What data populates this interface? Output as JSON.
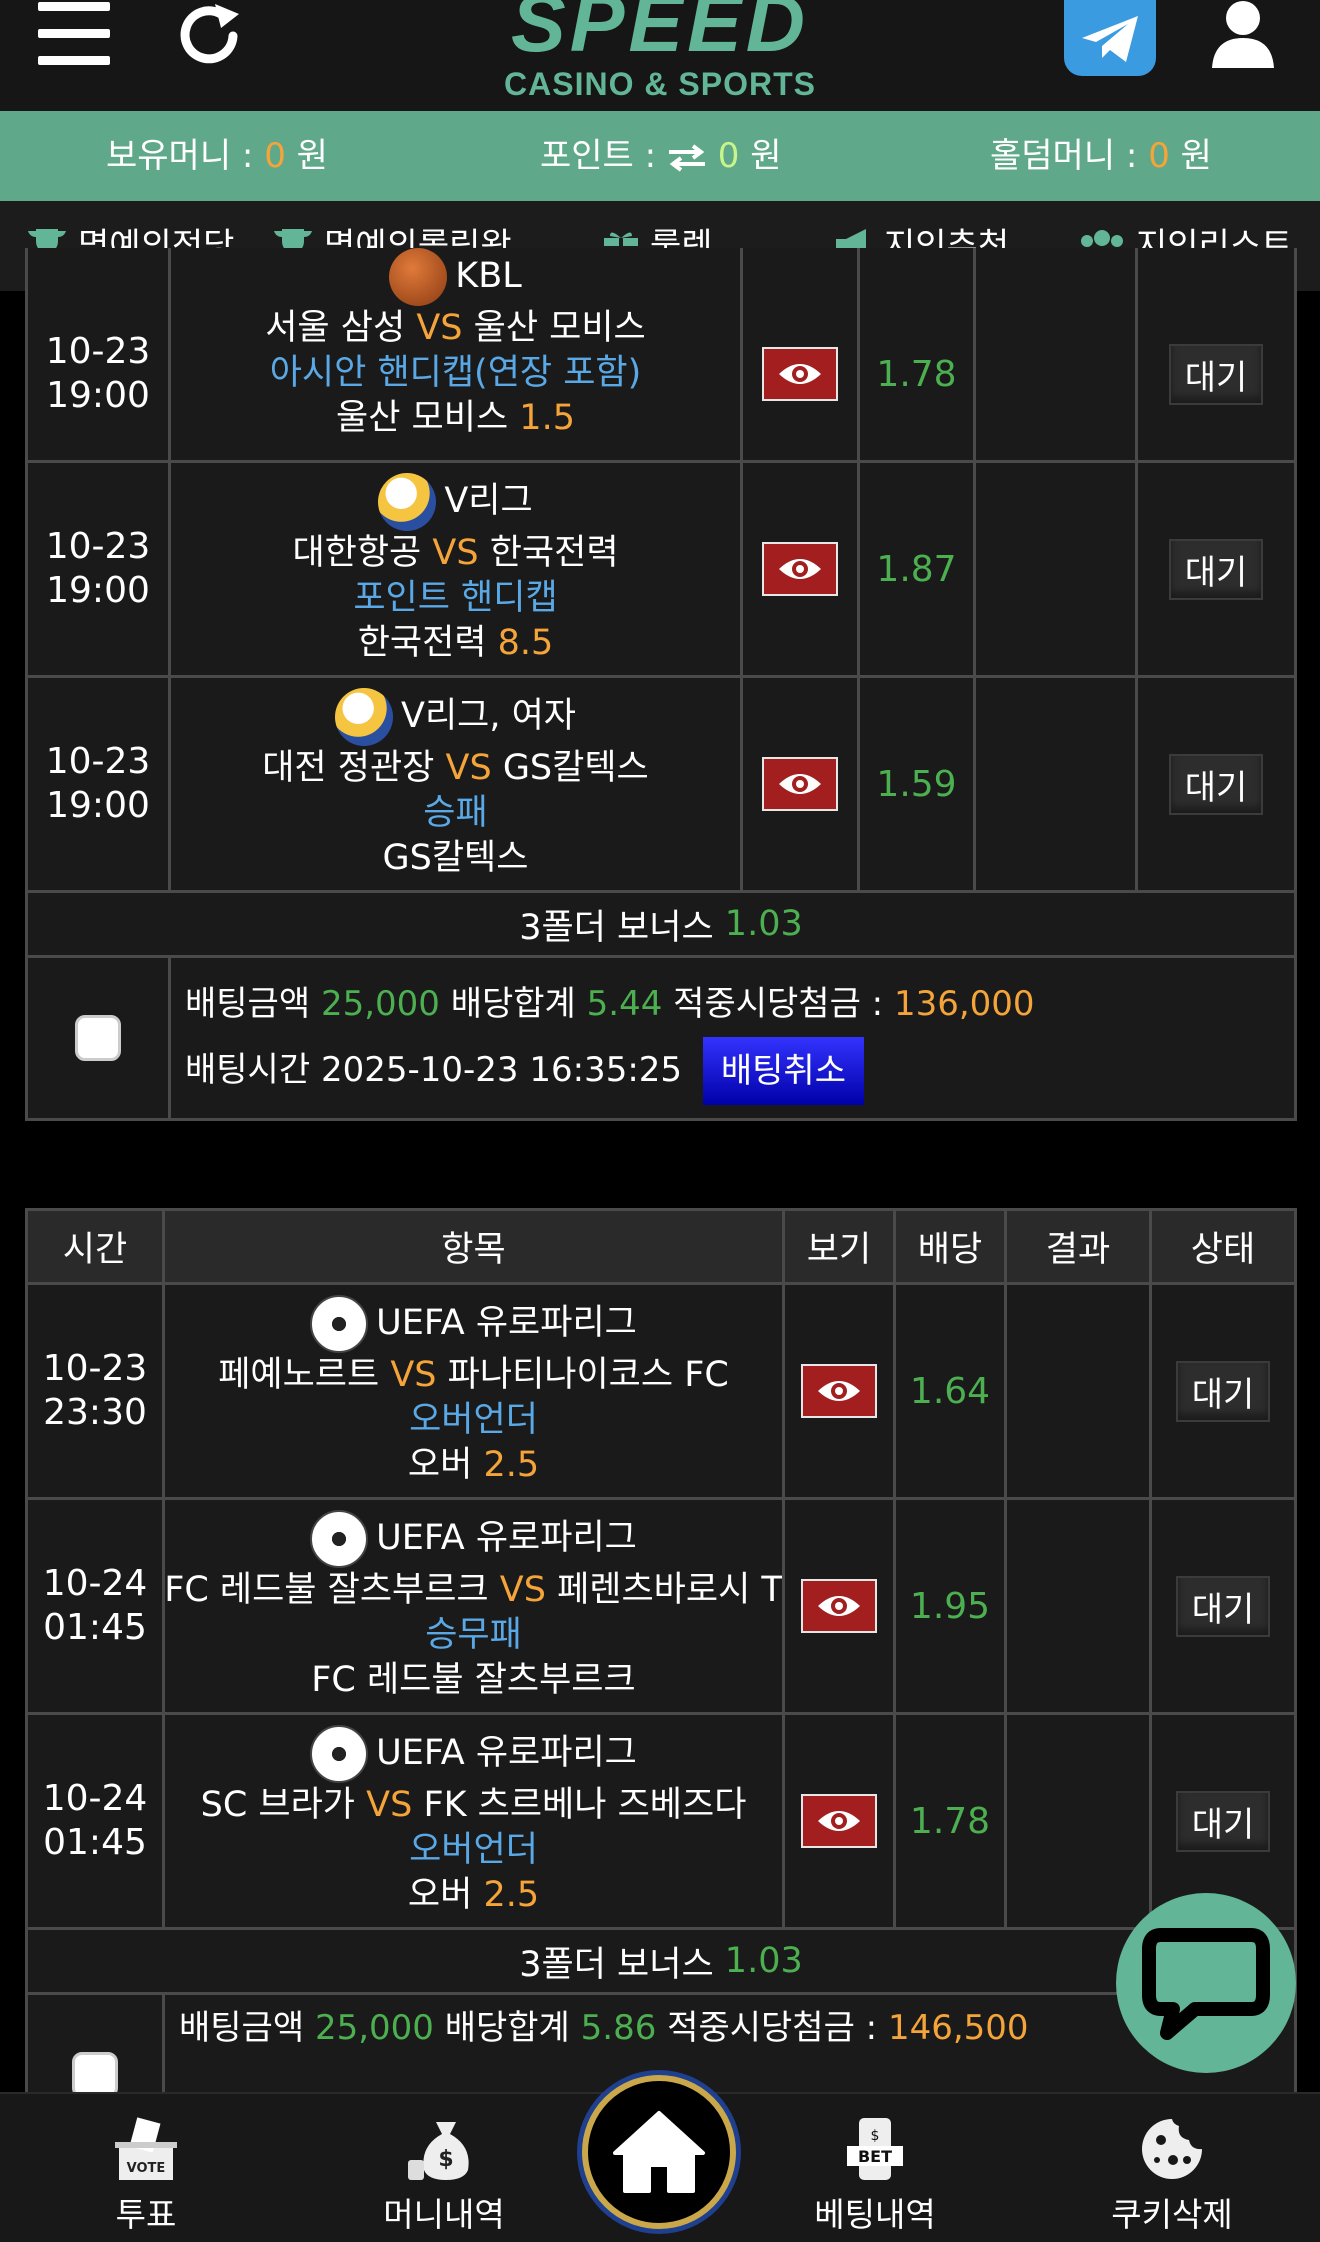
{
  "header": {
    "logo_main": "SPEED",
    "logo_sub": "CASINO & SPORTS"
  },
  "moneybar": {
    "balance_label": "보유머니 :",
    "balance_value": "0",
    "balance_unit": "원",
    "point_label": "포인트 :",
    "point_value": "0",
    "point_unit": "원",
    "holdem_label": "홀덤머니 :",
    "holdem_value": "0",
    "holdem_unit": "원"
  },
  "nav": {
    "items": [
      {
        "label": "명예의전당",
        "icon": "trophy-icon"
      },
      {
        "label": "명예의롤링왕",
        "icon": "trophy-icon"
      },
      {
        "label": "룰렛",
        "icon": "gift-icon"
      },
      {
        "label": "지인추천",
        "icon": "megaphone-icon"
      },
      {
        "label": "지인리스트",
        "icon": "users-icon"
      }
    ]
  },
  "slip1": {
    "rows": [
      {
        "date": "10-23",
        "time": "19:00",
        "league": "KBL",
        "home": "서울 삼성",
        "vs": "VS",
        "away": "울산 모비스",
        "market": "아시안 핸디캡(연장 포함)",
        "pick": "울산 모비스",
        "pick_value": "1.5",
        "odds": "1.78",
        "status": "대기"
      },
      {
        "date": "10-23",
        "time": "19:00",
        "league": "V리그",
        "home": "대한항공",
        "vs": "VS",
        "away": "한국전력",
        "market": "포인트 핸디캡",
        "pick": "한국전력",
        "pick_value": "8.5",
        "odds": "1.87",
        "status": "대기"
      },
      {
        "date": "10-23",
        "time": "19:00",
        "league": "V리그, 여자",
        "home": "대전 정관장",
        "vs": "VS",
        "away": "GS칼텍스",
        "market": "승패",
        "pick": "GS칼텍스",
        "pick_value": "",
        "odds": "1.59",
        "status": "대기"
      }
    ],
    "bonus_label": "3폴더 보너스",
    "bonus_value": "1.03",
    "bet_amount_label": "배팅금액",
    "bet_amount": "25,000",
    "odds_total_label": "배당합계",
    "odds_total": "5.44",
    "win_label": "적중시당첨금 :",
    "win_amount": "136,000",
    "bet_time_label": "배팅시간",
    "bet_time": "2025-10-23 16:35:25",
    "cancel_label": "배팅취소"
  },
  "slip2": {
    "headers": [
      "시간",
      "항목",
      "보기",
      "배당",
      "결과",
      "상태"
    ],
    "rows": [
      {
        "date": "10-23",
        "time": "23:30",
        "league": "UEFA 유로파리그",
        "home": "페예노르트",
        "vs": "VS",
        "away": "파나티나이코스 FC",
        "market": "오버언더",
        "pick": "오버",
        "pick_value": "2.5",
        "odds": "1.64",
        "status": "대기"
      },
      {
        "date": "10-24",
        "time": "01:45",
        "league": "UEFA 유로파리그",
        "home": "FC 레드불 잘츠부르크",
        "vs": "VS",
        "away": "페렌츠바로시 T",
        "market": "승무패",
        "pick": "FC 레드불 잘츠부르크",
        "pick_value": "",
        "odds": "1.95",
        "status": "대기"
      },
      {
        "date": "10-24",
        "time": "01:45",
        "league": "UEFA 유로파리그",
        "home": "SC 브라가",
        "vs": "VS",
        "away": "FK 츠르베나 즈베즈다",
        "market": "오버언더",
        "pick": "오버",
        "pick_value": "2.5",
        "odds": "1.78",
        "status": "대기"
      }
    ],
    "bonus_label": "3폴더 보너스",
    "bonus_value": "1.03",
    "bet_amount_label": "배팅금액",
    "bet_amount": "25,000",
    "odds_total_label": "배당합계",
    "odds_total": "5.86",
    "win_label": "적중시당첨금 :",
    "win_amount": "146,500"
  },
  "bottombar": {
    "items": [
      {
        "label": "투표",
        "icon": "vote-box-icon"
      },
      {
        "label": "머니내역",
        "icon": "money-bag-icon"
      },
      {
        "label": "베팅내역",
        "icon": "bet-phone-icon"
      },
      {
        "label": "쿠키삭제",
        "icon": "cookie-icon"
      }
    ],
    "home_icon": "home-icon"
  },
  "colors": {
    "brand": "#62b596",
    "accent_orange": "#f5a43a",
    "odds_green": "#4caf50",
    "market_blue": "#5aa9e6",
    "eye_red": "#a31f1f"
  }
}
